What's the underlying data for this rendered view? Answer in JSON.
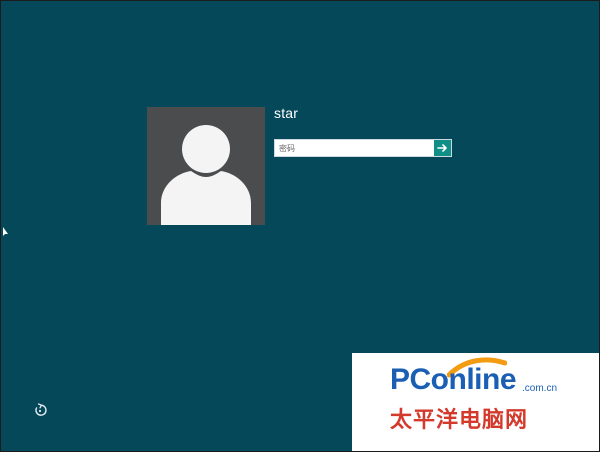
{
  "login": {
    "user_name": "star",
    "password_placeholder": "密码",
    "submit_icon": "arrow-right-icon"
  },
  "corner": {
    "ease_of_access_icon": "ease-of-access-icon"
  },
  "watermark": {
    "brand": "PConline",
    "domain": ".com.cn",
    "chinese": "太平洋电脑网"
  },
  "colors": {
    "background": "#04485a",
    "avatar_tile": "#4b4c4d",
    "submit_button": "#0f8f86",
    "watermark_blue": "#1a5fb4",
    "watermark_red": "#d33a2c"
  }
}
